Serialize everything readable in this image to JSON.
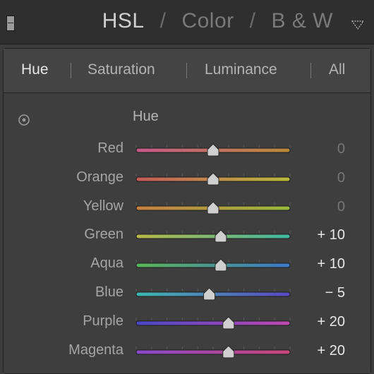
{
  "header": {
    "title_parts": [
      "HSL",
      "Color",
      "B & W"
    ],
    "separator": "/",
    "active_part": "HSL"
  },
  "tabs": [
    {
      "label": "Hue",
      "active": true
    },
    {
      "label": "Saturation",
      "active": false
    },
    {
      "label": "Luminance",
      "active": false
    },
    {
      "label": "All",
      "active": false
    }
  ],
  "section": {
    "label": "Hue",
    "target_icon": "target-adjust-icon"
  },
  "sliders": {
    "min": -100,
    "max": 100,
    "rows": [
      {
        "name": "red",
        "label": "Red",
        "value": 0,
        "display": "0",
        "colors": [
          "#c65a8a",
          "#b98a3a"
        ]
      },
      {
        "name": "orange",
        "label": "Orange",
        "value": 0,
        "display": "0",
        "colors": [
          "#c65a5a",
          "#b8bb3a"
        ]
      },
      {
        "name": "yellow",
        "label": "Yellow",
        "value": 0,
        "display": "0",
        "colors": [
          "#c88040",
          "#98b840"
        ]
      },
      {
        "name": "green",
        "label": "Green",
        "value": 10,
        "display": "+ 10",
        "colors": [
          "#b8b848",
          "#40b8a0"
        ]
      },
      {
        "name": "aqua",
        "label": "Aqua",
        "value": 10,
        "display": "+ 10",
        "colors": [
          "#58b858",
          "#3a78c8"
        ]
      },
      {
        "name": "blue",
        "label": "Blue",
        "value": -5,
        "display": "− 5",
        "colors": [
          "#40b8b0",
          "#5a48c0"
        ]
      },
      {
        "name": "purple",
        "label": "Purple",
        "value": 20,
        "display": "+ 20",
        "colors": [
          "#4848c8",
          "#c048b0"
        ]
      },
      {
        "name": "magenta",
        "label": "Magenta",
        "value": 20,
        "display": "+ 20",
        "colors": [
          "#8848c8",
          "#c84878"
        ]
      }
    ]
  }
}
